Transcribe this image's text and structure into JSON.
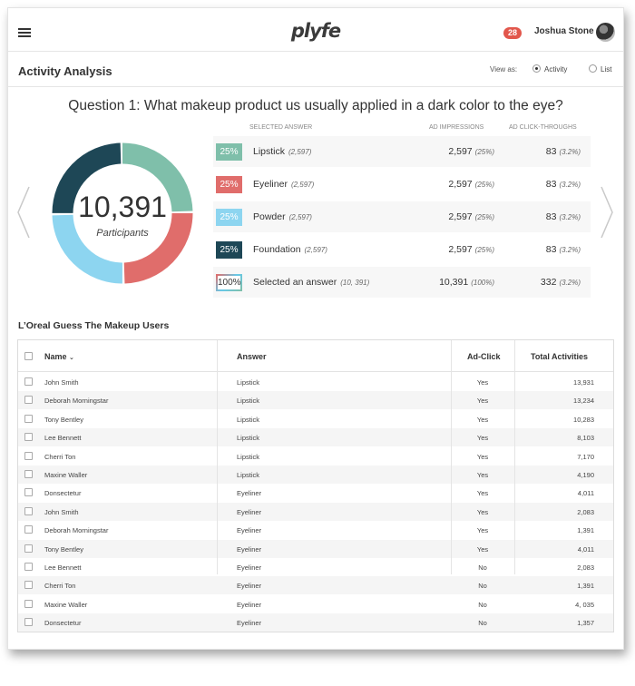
{
  "header": {
    "logo": "plyfe",
    "notification_count": "28",
    "username": "Joshua Stone"
  },
  "subheader": {
    "title": "Activity Analysis",
    "view_as_label": "View as:",
    "options": [
      "Activity",
      "List"
    ],
    "selected": "Activity"
  },
  "question": "Question 1: What makeup product us usually applied in a dark color to the eye?",
  "summary": {
    "participants_value": "10,391",
    "participants_label": "Participants",
    "columns": [
      "SELECTED ANSWER",
      "AD IMPRESSIONS",
      "AD CLICK-THROUGHS"
    ],
    "answers": [
      {
        "pct": "25%",
        "name": "Lipstick",
        "count": "(2,597)",
        "impressions": "2,597",
        "imp_pct": "(25%)",
        "clicks": "83",
        "clk_pct": "(3.2%)",
        "color": "#7fbfaa",
        "share": 0.25
      },
      {
        "pct": "25%",
        "name": "Eyeliner",
        "count": "(2,597)",
        "impressions": "2,597",
        "imp_pct": "(25%)",
        "clicks": "83",
        "clk_pct": "(3.2%)",
        "color": "#e06d6b",
        "share": 0.25
      },
      {
        "pct": "25%",
        "name": "Powder",
        "count": "(2,597)",
        "impressions": "2,597",
        "imp_pct": "(25%)",
        "clicks": "83",
        "clk_pct": "(3.2%)",
        "color": "#8dd5f0",
        "share": 0.25
      },
      {
        "pct": "25%",
        "name": "Foundation",
        "count": "(2,597)",
        "impressions": "2,597",
        "imp_pct": "(25%)",
        "clicks": "83",
        "clk_pct": "(3.2%)",
        "color": "#1e4756",
        "share": 0.25
      },
      {
        "pct": "100%",
        "name": "Selected an answer",
        "count": "(10, 391)",
        "impressions": "10,391",
        "imp_pct": "(100%)",
        "clicks": "332",
        "clk_pct": "(3.2%)",
        "color": "multi"
      }
    ]
  },
  "users": {
    "section_title": "L’Oreal Guess The Makeup Users",
    "columns": {
      "name": "Name",
      "answer": "Answer",
      "ad_click": "Ad-Click",
      "total": "Total Activities"
    },
    "rows": [
      {
        "name": "John Smith",
        "answer": "Lipstick",
        "ad_click": "Yes",
        "total": "13,931"
      },
      {
        "name": "Deborah Morningstar",
        "answer": "Lipstick",
        "ad_click": "Yes",
        "total": "13,234"
      },
      {
        "name": "Tony Bentley",
        "answer": "Lipstick",
        "ad_click": "Yes",
        "total": "10,283"
      },
      {
        "name": "Lee Bennett",
        "answer": "Lipstick",
        "ad_click": "Yes",
        "total": "8,103"
      },
      {
        "name": "Cherri Ton",
        "answer": "Lipstick",
        "ad_click": "Yes",
        "total": "7,170"
      },
      {
        "name": "Maxine Waller",
        "answer": "Lipstick",
        "ad_click": "Yes",
        "total": "4,190"
      },
      {
        "name": "Donsectetur",
        "answer": "Eyeliner",
        "ad_click": "Yes",
        "total": "4,011"
      },
      {
        "name": "John Smith",
        "answer": "Eyeliner",
        "ad_click": "Yes",
        "total": "2,083"
      },
      {
        "name": "Deborah Morningstar",
        "answer": "Eyeliner",
        "ad_click": "Yes",
        "total": "1,391"
      },
      {
        "name": "Tony Bentley",
        "answer": "Eyeliner",
        "ad_click": "Yes",
        "total": "4,011"
      },
      {
        "name": "Lee Bennett",
        "answer": "Eyeliner",
        "ad_click": "No",
        "total": "2,083"
      },
      {
        "name": "Cherri Ton",
        "answer": "Eyeliner",
        "ad_click": "No",
        "total": "1,391"
      },
      {
        "name": "Maxine Waller",
        "answer": "Eyeliner",
        "ad_click": "No",
        "total": "4, 035"
      },
      {
        "name": "Donsectetur",
        "answer": "Eyeliner",
        "ad_click": "No",
        "total": "1,357"
      }
    ]
  }
}
